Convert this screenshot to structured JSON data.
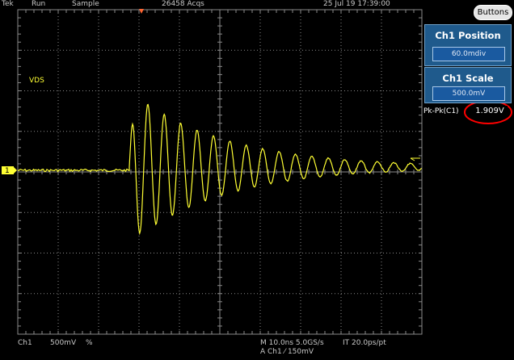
{
  "topbar": {
    "brand": "Tek",
    "state": "Run",
    "mode": "Sample",
    "acqs": "26458 Acqs",
    "datetime": "25 Jul 19 17:39:00"
  },
  "buttons_label": "Buttons",
  "channel_label": "VDS",
  "ground_marker": "1",
  "panels": {
    "position": {
      "title": "Ch1 Position",
      "value": "60.0mdiv"
    },
    "scale": {
      "title": "Ch1 Scale",
      "value": "500.0mV"
    }
  },
  "measurement": {
    "label": "Pk-Pk(C1)",
    "value": "1.909V"
  },
  "bottombar": {
    "channel": "Ch1",
    "volts_per_div": "500mV",
    "coupling_symbol": "%",
    "timebase": "M 10.0ns 5.0GS/s",
    "interp": "IT 20.0ps/pt",
    "trigger": "A  Ch1  ⁄  150mV"
  },
  "colors": {
    "trace": "#ffff33",
    "grid": "#8a8a8a",
    "panel": "#1f5a8c",
    "highlight_circle": "#ff0000",
    "trigger_marker": "#ff6633"
  }
}
